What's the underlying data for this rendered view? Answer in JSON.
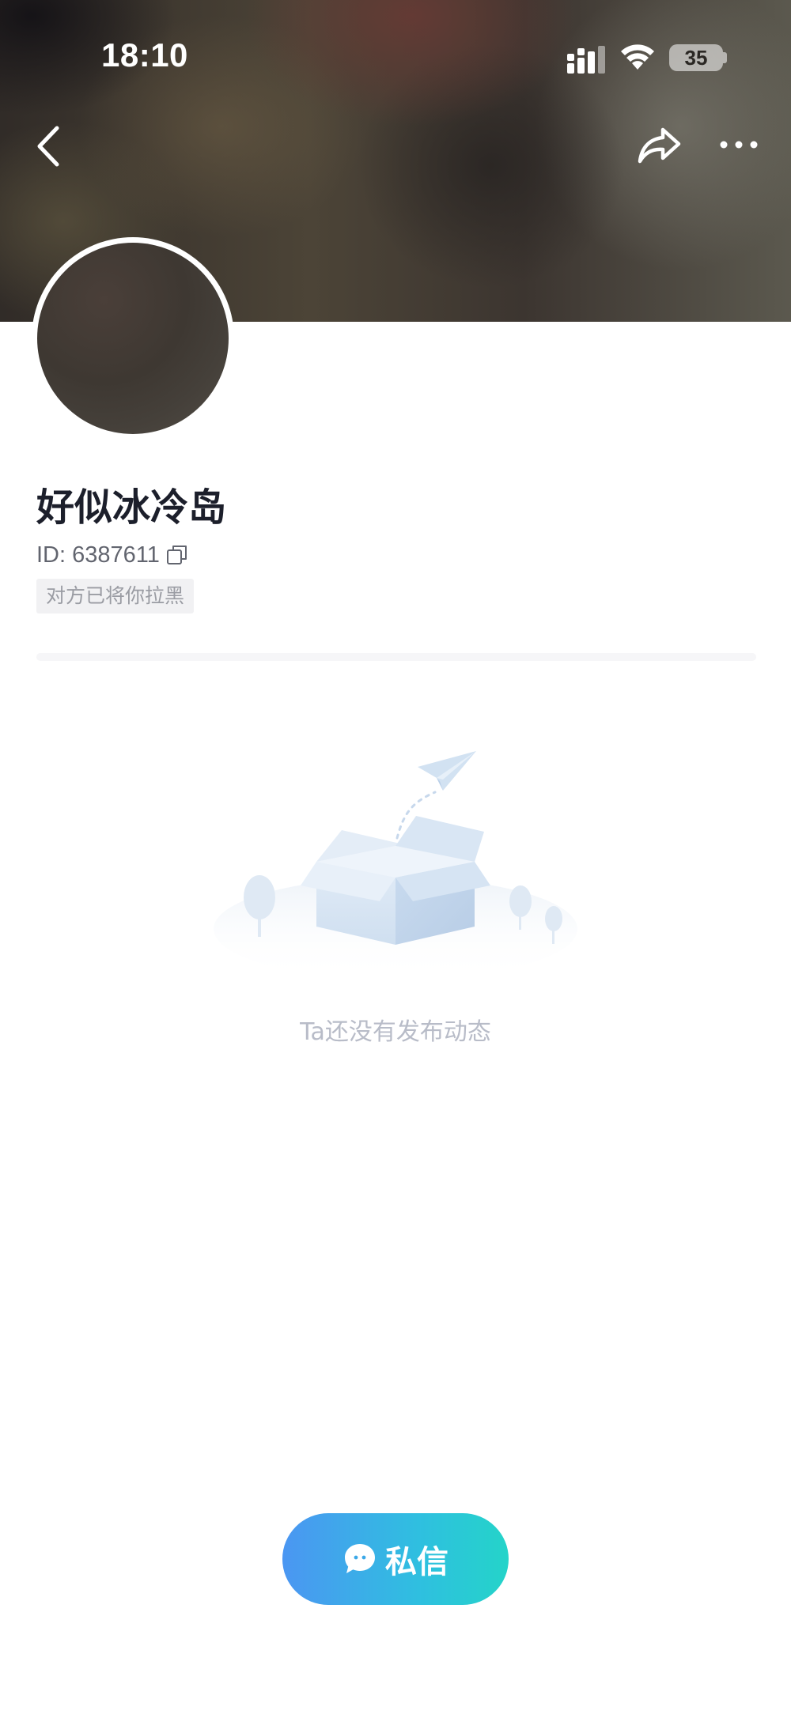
{
  "status_bar": {
    "time": "18:10",
    "battery": "35"
  },
  "nav": {
    "back_icon": "chevron-left-icon",
    "share_icon": "share-arrow-icon",
    "more_icon": "more-dots-icon"
  },
  "profile": {
    "name": "好似冰冷岛",
    "id_text": "ID: 6387611",
    "blocked_tag": "对方已将你拉黑"
  },
  "empty_state": {
    "message": "Ta还没有发布动态",
    "illustration_icon": "empty-box-paper-plane-icon"
  },
  "actions": {
    "message_label": "私信",
    "message_icon": "chat-bubble-icon"
  },
  "colors": {
    "accent_start": "#4b96f2",
    "accent_end": "#24d4c9",
    "name_text": "#1c1f2b",
    "muted_text": "#b8bcc8"
  }
}
